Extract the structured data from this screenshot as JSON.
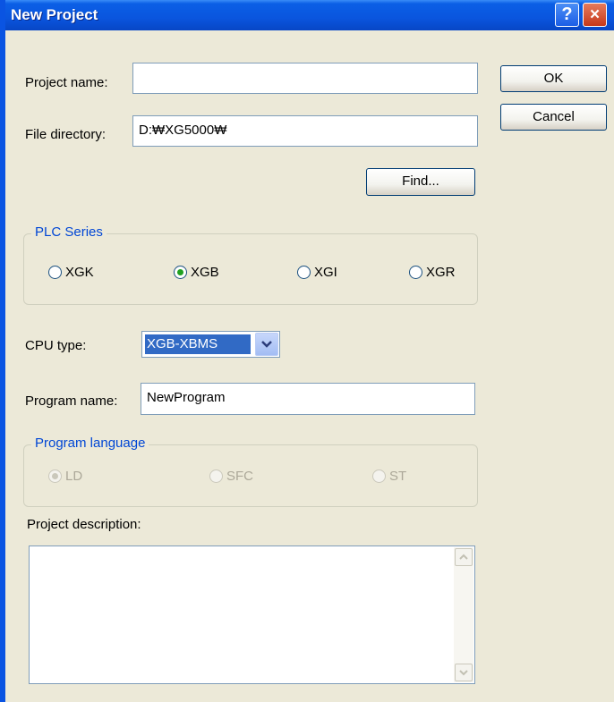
{
  "window": {
    "title": "New Project",
    "help_label": "?",
    "close_label": "×"
  },
  "form": {
    "project_name_label": "Project name:",
    "project_name_value": "",
    "file_directory_label": "File directory:",
    "file_directory_value": "D:₩XG5000₩",
    "find_button": "Find...",
    "plc_series_label": "PLC Series",
    "plc_options": [
      {
        "label": "XGK",
        "selected": false
      },
      {
        "label": "XGB",
        "selected": true
      },
      {
        "label": "XGI",
        "selected": false
      },
      {
        "label": "XGR",
        "selected": false
      }
    ],
    "cpu_type_label": "CPU type:",
    "cpu_type_value": "XGB-XBMS",
    "program_name_label": "Program name:",
    "program_name_value": "NewProgram",
    "program_language_label": "Program language",
    "language_options": [
      {
        "label": "LD",
        "selected": true,
        "enabled": false
      },
      {
        "label": "SFC",
        "selected": false,
        "enabled": false
      },
      {
        "label": "ST",
        "selected": false,
        "enabled": false
      }
    ],
    "project_description_label": "Project description:",
    "project_description_value": ""
  },
  "buttons": {
    "ok": "OK",
    "cancel": "Cancel"
  },
  "colors": {
    "titlebar": "#0A55DE",
    "dialog_bg": "#ECE9D8",
    "group_label": "#0046D5",
    "selection": "#316AC5"
  }
}
